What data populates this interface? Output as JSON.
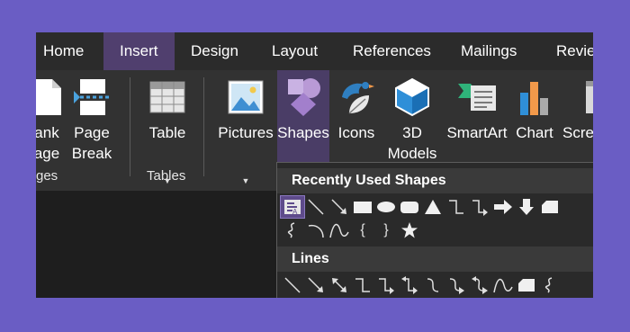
{
  "tabs": [
    "Home",
    "Insert",
    "Design",
    "Layout",
    "References",
    "Mailings",
    "Review"
  ],
  "ribbon": {
    "blank_page": "ank\nage",
    "page_break": "Page\nBreak",
    "pages_group": "ges",
    "table": "Table",
    "tables_group": "Tables",
    "pictures": "Pictures",
    "shapes": "Shapes",
    "icons": "Icons",
    "models_3d": "3D\nModels",
    "smartart": "SmartArt",
    "chart": "Chart",
    "screenshot": "Scre"
  },
  "shapes_panel": {
    "recent_title": "Recently Used Shapes",
    "lines_title": "Lines",
    "curly_open": "{",
    "curly_close": "}"
  },
  "colors": {
    "accent": "#503f6e",
    "background": "#6a5dc4"
  }
}
